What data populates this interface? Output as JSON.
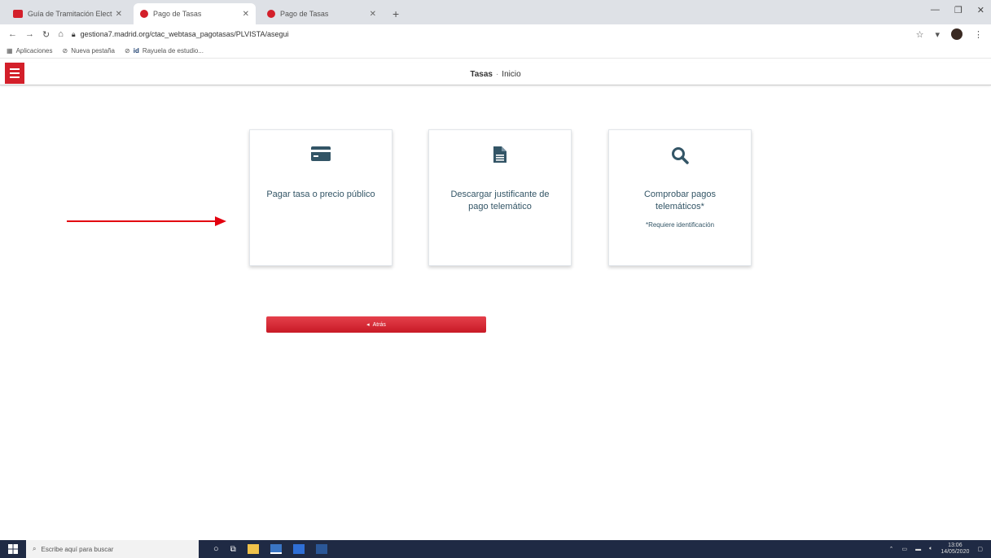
{
  "browser": {
    "tabs": [
      {
        "title": "Guía de Tramitación Electrónica",
        "favicon_color": "#d31f2a",
        "active": false
      },
      {
        "title": "Pago de Tasas",
        "favicon_color": "#d31f2a",
        "active": true
      },
      {
        "title": "Pago de Tasas",
        "favicon_color": "#d31f2a",
        "active": false
      }
    ],
    "new_tab_label": "+",
    "url": "gestiona7.madrid.org/ctac_webtasa_pagotasas/PLVISTA/asegui",
    "bookmarks": [
      "Aplicaciones",
      "Nueva pestaña",
      "Rayuela de estudio..."
    ]
  },
  "header": {
    "title_strong": "Tasas",
    "separator": "·",
    "title_rest": "Inicio"
  },
  "cards": [
    {
      "label": "Pagar tasa o precio público",
      "icon": "credit-card-icon"
    },
    {
      "label": "Descargar justificante de pago telemático",
      "icon": "document-icon"
    },
    {
      "label": "Comprobar pagos telemáticos*",
      "note": "*Requiere identificación",
      "icon": "search-icon"
    }
  ],
  "back_button": {
    "label": "Atrás"
  },
  "taskbar": {
    "search_placeholder": "Escribe aquí para buscar",
    "time": "13:06",
    "date": "14/05/2020"
  },
  "colors": {
    "accent": "#d31f2a",
    "card_text": "#335566",
    "arrow": "#e3000f",
    "taskbar": "#1f2a44"
  }
}
